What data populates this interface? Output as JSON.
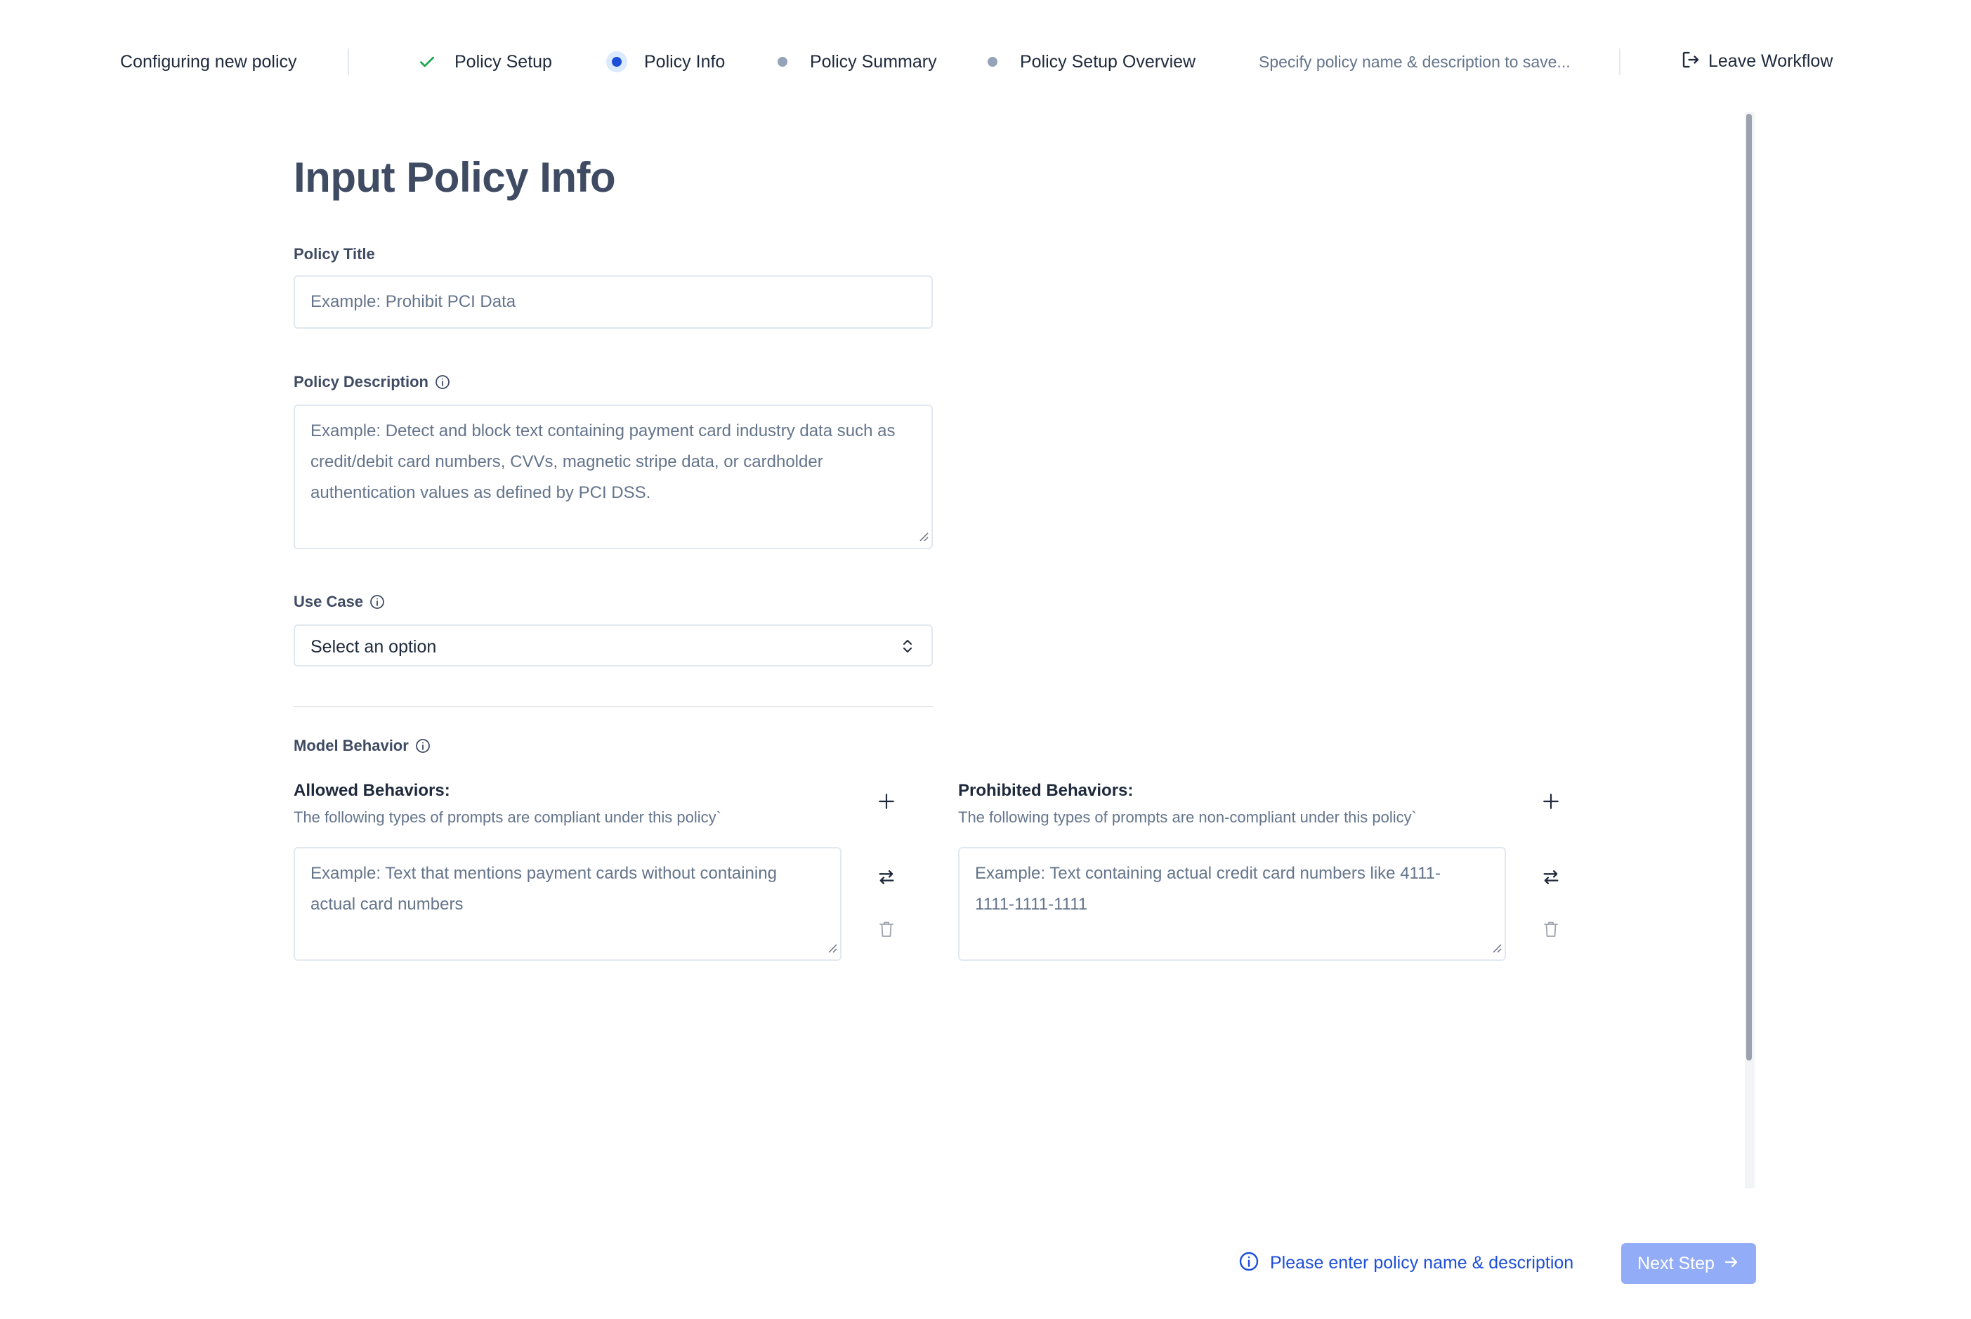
{
  "header": {
    "title": "Configuring new policy",
    "steps": [
      {
        "label": "Policy Setup",
        "state": "complete"
      },
      {
        "label": "Policy Info",
        "state": "active"
      },
      {
        "label": "Policy Summary",
        "state": "pending"
      },
      {
        "label": "Policy Setup Overview",
        "state": "pending"
      }
    ],
    "hint": "Specify policy name & description to save...",
    "leave_label": "Leave Workflow"
  },
  "main": {
    "title": "Input Policy Info",
    "policy_title": {
      "label": "Policy Title",
      "placeholder": "Example: Prohibit PCI Data"
    },
    "policy_description": {
      "label": "Policy Description",
      "placeholder": "Example: Detect and block text containing payment card industry data such as credit/debit card numbers, CVVs, magnetic stripe data, or cardholder authentication values as defined by PCI DSS."
    },
    "use_case": {
      "label": "Use Case",
      "value": "Select an option"
    },
    "model_behavior": {
      "label": "Model Behavior",
      "allowed": {
        "title": "Allowed Behaviors:",
        "description": "The following types of prompts are compliant under this policy`",
        "placeholder": "Example: Text that mentions payment cards without containing actual card numbers"
      },
      "prohibited": {
        "title": "Prohibited Behaviors:",
        "description": "The following types of prompts are non-compliant under this policy`",
        "placeholder": "Example: Text containing actual credit card numbers like 4111-1111-1111-1111"
      }
    }
  },
  "footer": {
    "hint": "Please enter policy name & description",
    "next_label": "Next Step"
  },
  "colors": {
    "accent": "#1d4ed8",
    "next_button": "#93acf7",
    "complete_check": "#16a34a",
    "heading": "#3f4b63"
  }
}
